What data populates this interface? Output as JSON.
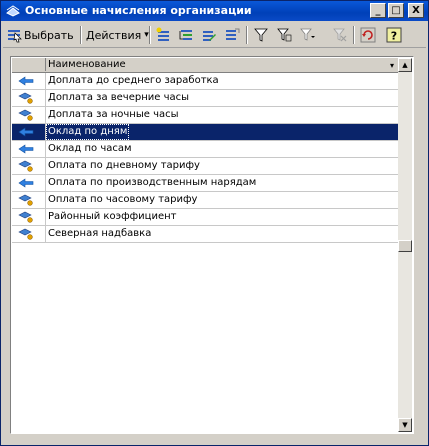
{
  "window": {
    "title": "Основные начисления организации"
  },
  "titlebar_buttons": {
    "minimize": "_",
    "maximize": "□",
    "close": "X"
  },
  "toolbar": {
    "select_label": "Выбрать",
    "actions_label": "Действия",
    "actions_arrow": "▾"
  },
  "toolbar_icons": [
    "select-icon",
    "add-icon",
    "add-group-icon",
    "edit-icon",
    "copy-icon",
    "filter-icon",
    "filter-settings-icon",
    "filter-off-icon",
    "refresh-icon",
    "help-icon"
  ],
  "table": {
    "header": "Наименование",
    "sort_indicator": "▾",
    "rows": [
      {
        "icon": "blue-arrow-icon",
        "name": "Доплата до среднего заработка"
      },
      {
        "icon": "item-icon",
        "name": "Доплата за вечерние часы"
      },
      {
        "icon": "item-icon",
        "name": "Доплата за ночные часы"
      },
      {
        "icon": "blue-arrow-icon",
        "name": "Оклад по дням",
        "selected": true
      },
      {
        "icon": "blue-arrow-icon",
        "name": "Оклад по часам"
      },
      {
        "icon": "item-icon",
        "name": "Оплата по дневному тарифу"
      },
      {
        "icon": "blue-arrow-icon",
        "name": "Оплата по производственным нарядам"
      },
      {
        "icon": "item-icon",
        "name": "Оплата по часовому тарифу"
      },
      {
        "icon": "item-icon",
        "name": "Районный коэффициент"
      },
      {
        "icon": "item-icon",
        "name": "Северная надбавка"
      }
    ]
  },
  "scrollbar": {
    "up": "▲",
    "down": "▼"
  }
}
